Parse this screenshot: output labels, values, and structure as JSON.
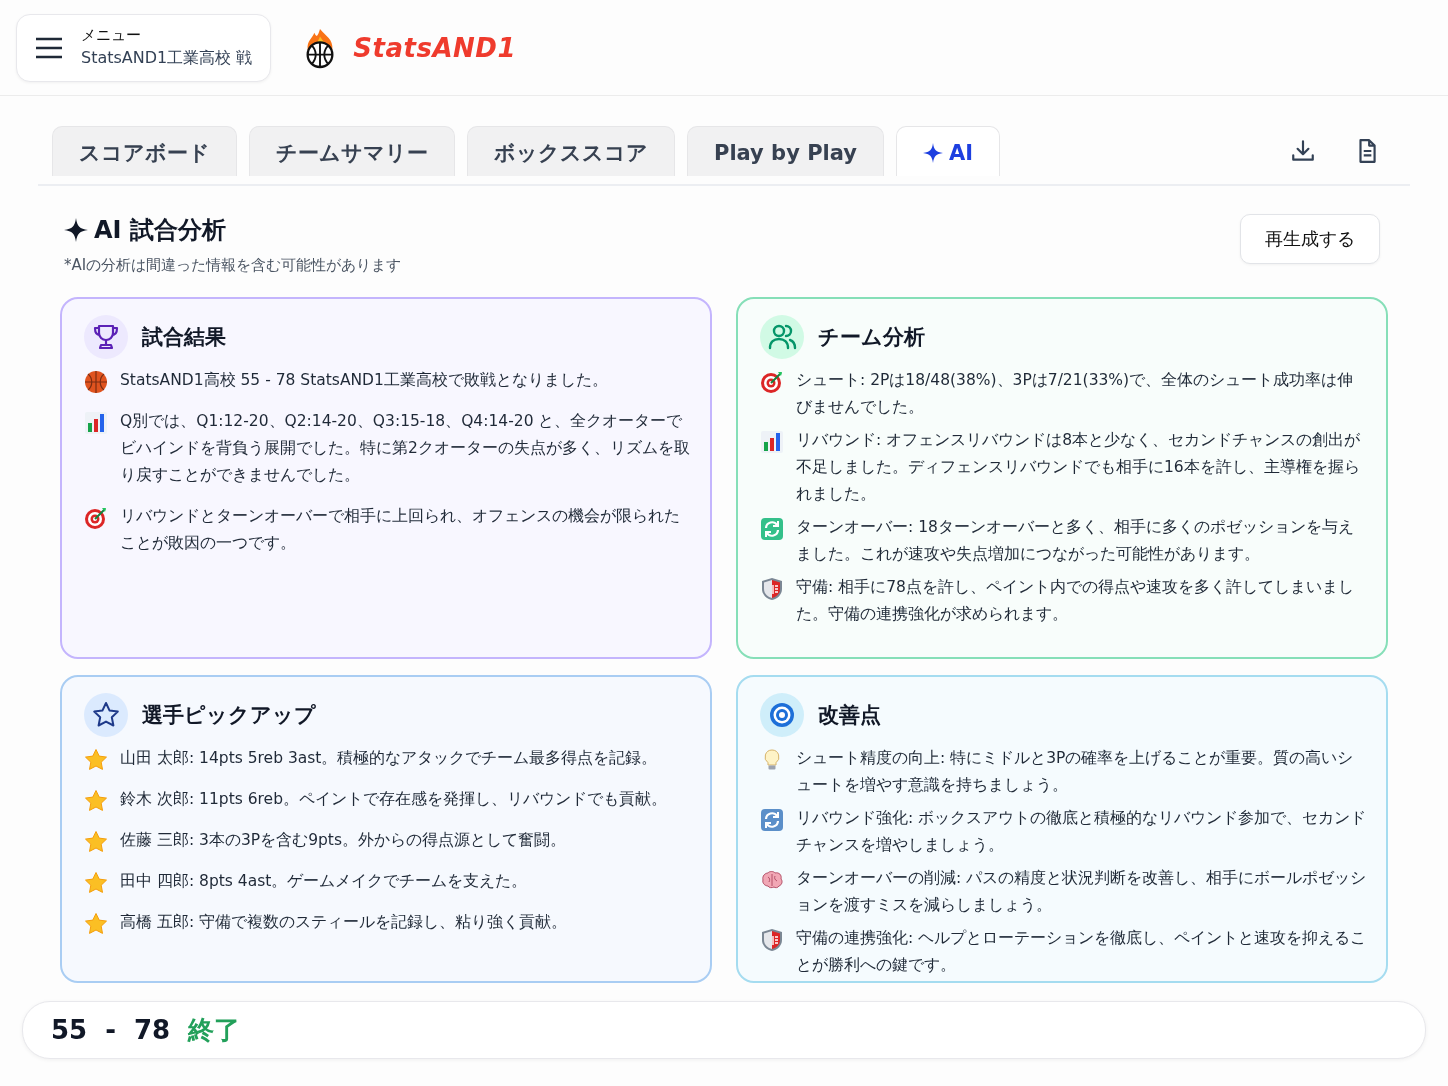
{
  "header": {
    "menu_label": "メニュー",
    "game_title": "StatsAND1工業高校 戦",
    "logo_text": "StatsAND1"
  },
  "tabs": [
    {
      "label": "スコアボード",
      "selected": false,
      "kind": "text"
    },
    {
      "label": "チームサマリー",
      "selected": false,
      "kind": "text"
    },
    {
      "label": "ボックススコア",
      "selected": false,
      "kind": "text"
    },
    {
      "label": "Play by Play",
      "selected": false,
      "kind": "text"
    },
    {
      "label": "AI",
      "selected": true,
      "kind": "ai"
    }
  ],
  "section": {
    "title": "AI 試合分析",
    "note": "*AIの分析は間違った情報を含む可能性があります",
    "regenerate_button": "再生成する"
  },
  "cards": [
    {
      "title": "試合結果",
      "kind": "trophy",
      "color": "#c4b5fd",
      "items": [
        {
          "kind": "basketball",
          "text": "StatsAND1高校 55 - 78 StatsAND1工業高校で敗戦となりました。"
        },
        {
          "kind": "chart",
          "text": "Q別では、Q1:12-20、Q2:14-20、Q3:15-18、Q4:14-20 と、全クオーターでビハインドを背負う展開でした。特に第2クオーターの失点が多く、リズムを取り戻すことができませんでした。"
        },
        {
          "kind": "target",
          "text": "リバウンドとターンオーバーで相手に上回られ、オフェンスの機会が限られたことが敗因の一つです。"
        }
      ]
    },
    {
      "title": "チーム分析",
      "kind": "people",
      "color": "#86dfb8",
      "items": [
        {
          "kind": "target",
          "text": "シュート: 2Pは18/48(38%)、3Pは7/21(33%)で、全体のシュート成功率は伸びませんでした。"
        },
        {
          "kind": "chart",
          "text": "リバウンド: オフェンスリバウンドは8本と少なく、セカンドチャンスの創出が不足しました。ディフェンスリバウンドでも相手に16本を許し、主導権を握られました。"
        },
        {
          "kind": "cycle",
          "text": "ターンオーバー: 18ターンオーバーと多く、相手に多くのポゼッションを与えました。これが速攻や失点増加につながった可能性があります。"
        },
        {
          "kind": "shield",
          "text": "守備: 相手に78点を許し、ペイント内での得点や速攻を多く許してしまいました。守備の連携強化が求められます。"
        }
      ]
    },
    {
      "title": "選手ピックアップ",
      "kind": "star",
      "color": "#a9cdf3",
      "items": [
        {
          "kind": "star",
          "text": "山田 太郎: 14pts 5reb 3ast。積極的なアタックでチーム最多得点を記録。"
        },
        {
          "kind": "star",
          "text": "鈴木 次郎: 11pts 6reb。ペイントで存在感を発揮し、リバウンドでも貢献。"
        },
        {
          "kind": "star",
          "text": "佐藤 三郎: 3本の3Pを含む9pts。外からの得点源として奮闘。"
        },
        {
          "kind": "star",
          "text": "田中 四郎: 8pts 4ast。ゲームメイクでチームを支えた。"
        },
        {
          "kind": "star",
          "text": "高橋 五郎: 守備で複数のスティールを記録し、粘り強く貢献。"
        }
      ]
    },
    {
      "title": "改善点",
      "kind": "bullseye",
      "color": "#a5dcf0",
      "items": [
        {
          "kind": "bulb",
          "text": "シュート精度の向上: 特にミドルと3Pの確率を上げることが重要。質の高いシュートを増やす意識を持ちましょう。"
        },
        {
          "kind": "cycle",
          "text": "リバウンド強化: ボックスアウトの徹底と積極的なリバウンド参加で、セカンドチャンスを増やしましょう。"
        },
        {
          "kind": "brain",
          "text": "ターンオーバーの削減: パスの精度と状況判断を改善し、相手にボールポゼッションを渡すミスを減らしましょう。"
        },
        {
          "kind": "shield",
          "text": "守備の連携強化: ヘルプとローテーションを徹底し、ペイントと速攻を抑えることが勝利への鍵です。"
        }
      ]
    }
  ],
  "score_bar": {
    "home": "55",
    "separator": "-",
    "away": "78",
    "status": "終了"
  }
}
